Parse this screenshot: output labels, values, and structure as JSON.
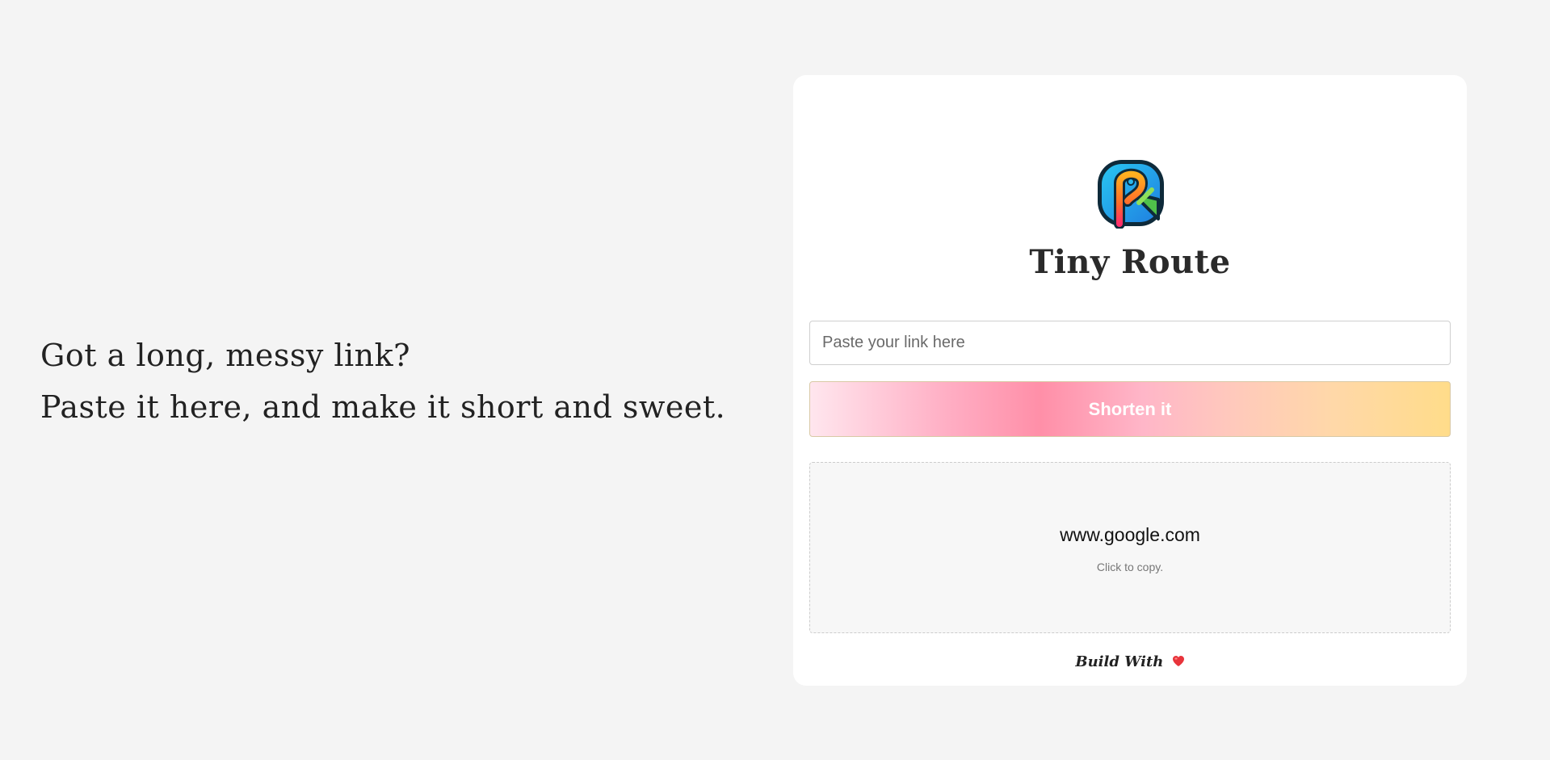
{
  "hero": {
    "line1": "Got a long, messy link?",
    "line2": "Paste it here, and make it short and sweet."
  },
  "brand": {
    "name": "Tiny Route",
    "logo_icon": "route-pin-icon"
  },
  "form": {
    "input_placeholder": "Paste your link here",
    "input_value": "",
    "button_label": "Shorten it"
  },
  "result": {
    "short_url": "www.google.com",
    "hint": "Click to copy."
  },
  "footer": {
    "text": "Build With",
    "icon": "heart-icon"
  },
  "colors": {
    "background": "#f4f4f4",
    "card": "#ffffff",
    "button_gradient_start": "#ffe6ee",
    "button_gradient_mid": "#ff8fa8",
    "button_gradient_end": "#ffdc8a",
    "heart": "#e8343b"
  }
}
